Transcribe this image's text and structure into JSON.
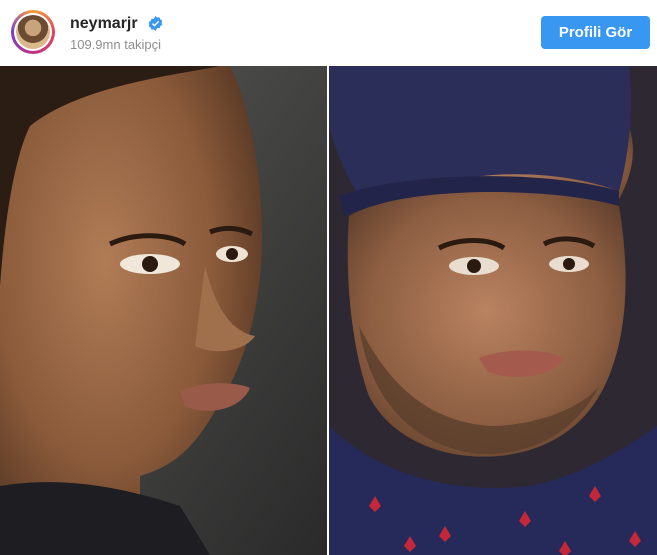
{
  "post": {
    "username": "neymarjr",
    "verified": true,
    "followers": "109.9mn takipçi",
    "profile_button": "Profili Gör"
  },
  "colors": {
    "button": "#3897f0",
    "username": "#262626",
    "secondary_text": "#8e8e8e",
    "verified_badge": "#3897f0"
  },
  "icons": {
    "verified": "verified-badge-icon"
  },
  "images": [
    {
      "name": "young-portrait-photo"
    },
    {
      "name": "older-portrait-photo"
    }
  ]
}
